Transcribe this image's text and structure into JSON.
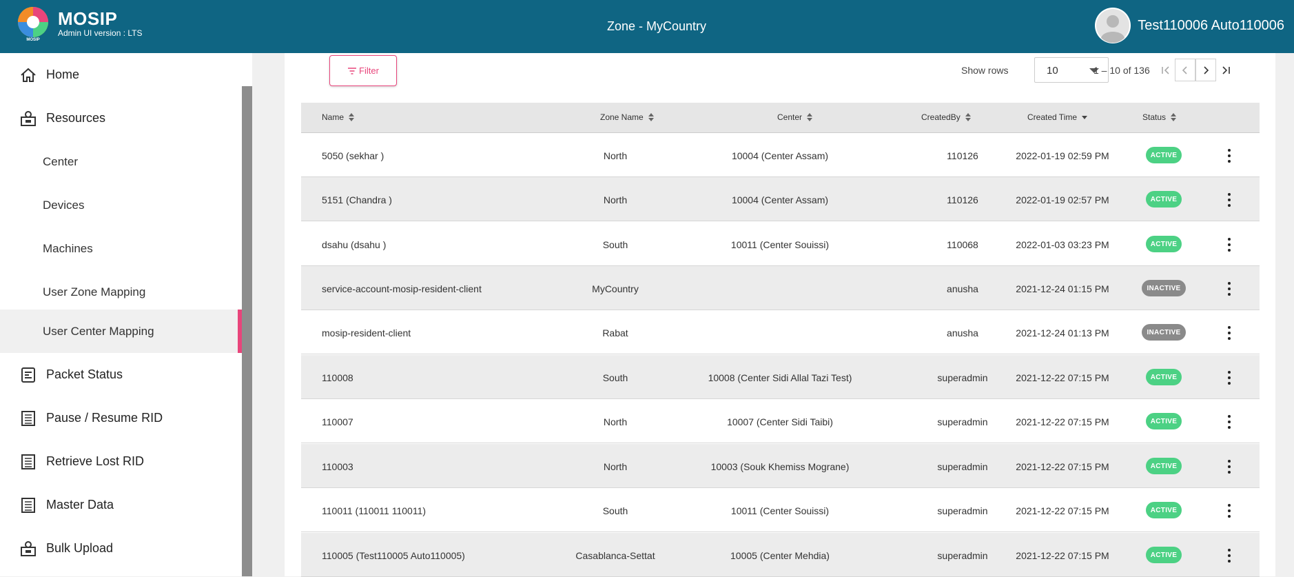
{
  "header": {
    "brand": "MOSIP",
    "version": "Admin UI version : LTS",
    "zone_title": "Zone - MyCountry",
    "user_name": "Test110006 Auto110006",
    "bg_color": "#0f6583"
  },
  "sidebar": {
    "items": [
      {
        "label": "Home",
        "icon": "home-icon"
      },
      {
        "label": "Resources",
        "icon": "resources-icon"
      },
      {
        "label": "Center"
      },
      {
        "label": "Devices"
      },
      {
        "label": "Machines"
      },
      {
        "label": "User Zone Mapping"
      },
      {
        "label": "User Center Mapping",
        "active": true
      },
      {
        "label": "Packet Status",
        "icon": "packet-status-icon"
      },
      {
        "label": "Pause / Resume RID",
        "icon": "list-icon"
      },
      {
        "label": "Retrieve Lost RID",
        "icon": "list-icon"
      },
      {
        "label": "Master Data",
        "icon": "list-icon"
      },
      {
        "label": "Bulk Upload",
        "icon": "upload-icon"
      }
    ],
    "active_color": "#e8457b"
  },
  "toolbar": {
    "filter_label": "Filter",
    "show_rows_label": "Show rows",
    "rows_per_page": "10",
    "range_label": "1 – 10 of 136"
  },
  "table": {
    "columns": [
      "Name",
      "Zone Name",
      "Center",
      "CreatedBy",
      "Created Time",
      "Status"
    ],
    "rows": [
      {
        "name": "5050 (sekhar )",
        "zone": "North",
        "center": "10004 (Center Assam)",
        "created_by": "110126",
        "created_time": "2022-01-19 02:59 PM",
        "status": "ACTIVE"
      },
      {
        "name": "5151 (Chandra )",
        "zone": "North",
        "center": "10004 (Center Assam)",
        "created_by": "110126",
        "created_time": "2022-01-19 02:57 PM",
        "status": "ACTIVE"
      },
      {
        "name": "dsahu (dsahu )",
        "zone": "South",
        "center": "10011 (Center Souissi)",
        "created_by": "110068",
        "created_time": "2022-01-03 03:23 PM",
        "status": "ACTIVE"
      },
      {
        "name": "service-account-mosip-resident-client",
        "zone": "MyCountry",
        "center": "",
        "created_by": "anusha",
        "created_time": "2021-12-24 01:15 PM",
        "status": "INACTIVE"
      },
      {
        "name": "mosip-resident-client",
        "zone": "Rabat",
        "center": "",
        "created_by": "anusha",
        "created_time": "2021-12-24 01:13 PM",
        "status": "INACTIVE"
      },
      {
        "name": "110008",
        "zone": "South",
        "center": "10008 (Center Sidi Allal Tazi Test)",
        "created_by": "superadmin",
        "created_time": "2021-12-22 07:15 PM",
        "status": "ACTIVE"
      },
      {
        "name": "110007",
        "zone": "North",
        "center": "10007 (Center Sidi Taibi)",
        "created_by": "superadmin",
        "created_time": "2021-12-22 07:15 PM",
        "status": "ACTIVE"
      },
      {
        "name": "110003",
        "zone": "North",
        "center": "10003 (Souk Khemiss Mograne)",
        "created_by": "superadmin",
        "created_time": "2021-12-22 07:15 PM",
        "status": "ACTIVE"
      },
      {
        "name": "110011 (110011 110011)",
        "zone": "South",
        "center": "10011 (Center Souissi)",
        "created_by": "superadmin",
        "created_time": "2021-12-22 07:15 PM",
        "status": "ACTIVE"
      },
      {
        "name": "110005 (Test110005 Auto110005)",
        "zone": "Casablanca-Settat",
        "center": "10005 (Center Mehdia)",
        "created_by": "superadmin",
        "created_time": "2021-12-22 07:15 PM",
        "status": "ACTIVE"
      }
    ]
  },
  "colors": {
    "active_badge": "#4cd184",
    "inactive_badge": "#8a8a8a"
  }
}
